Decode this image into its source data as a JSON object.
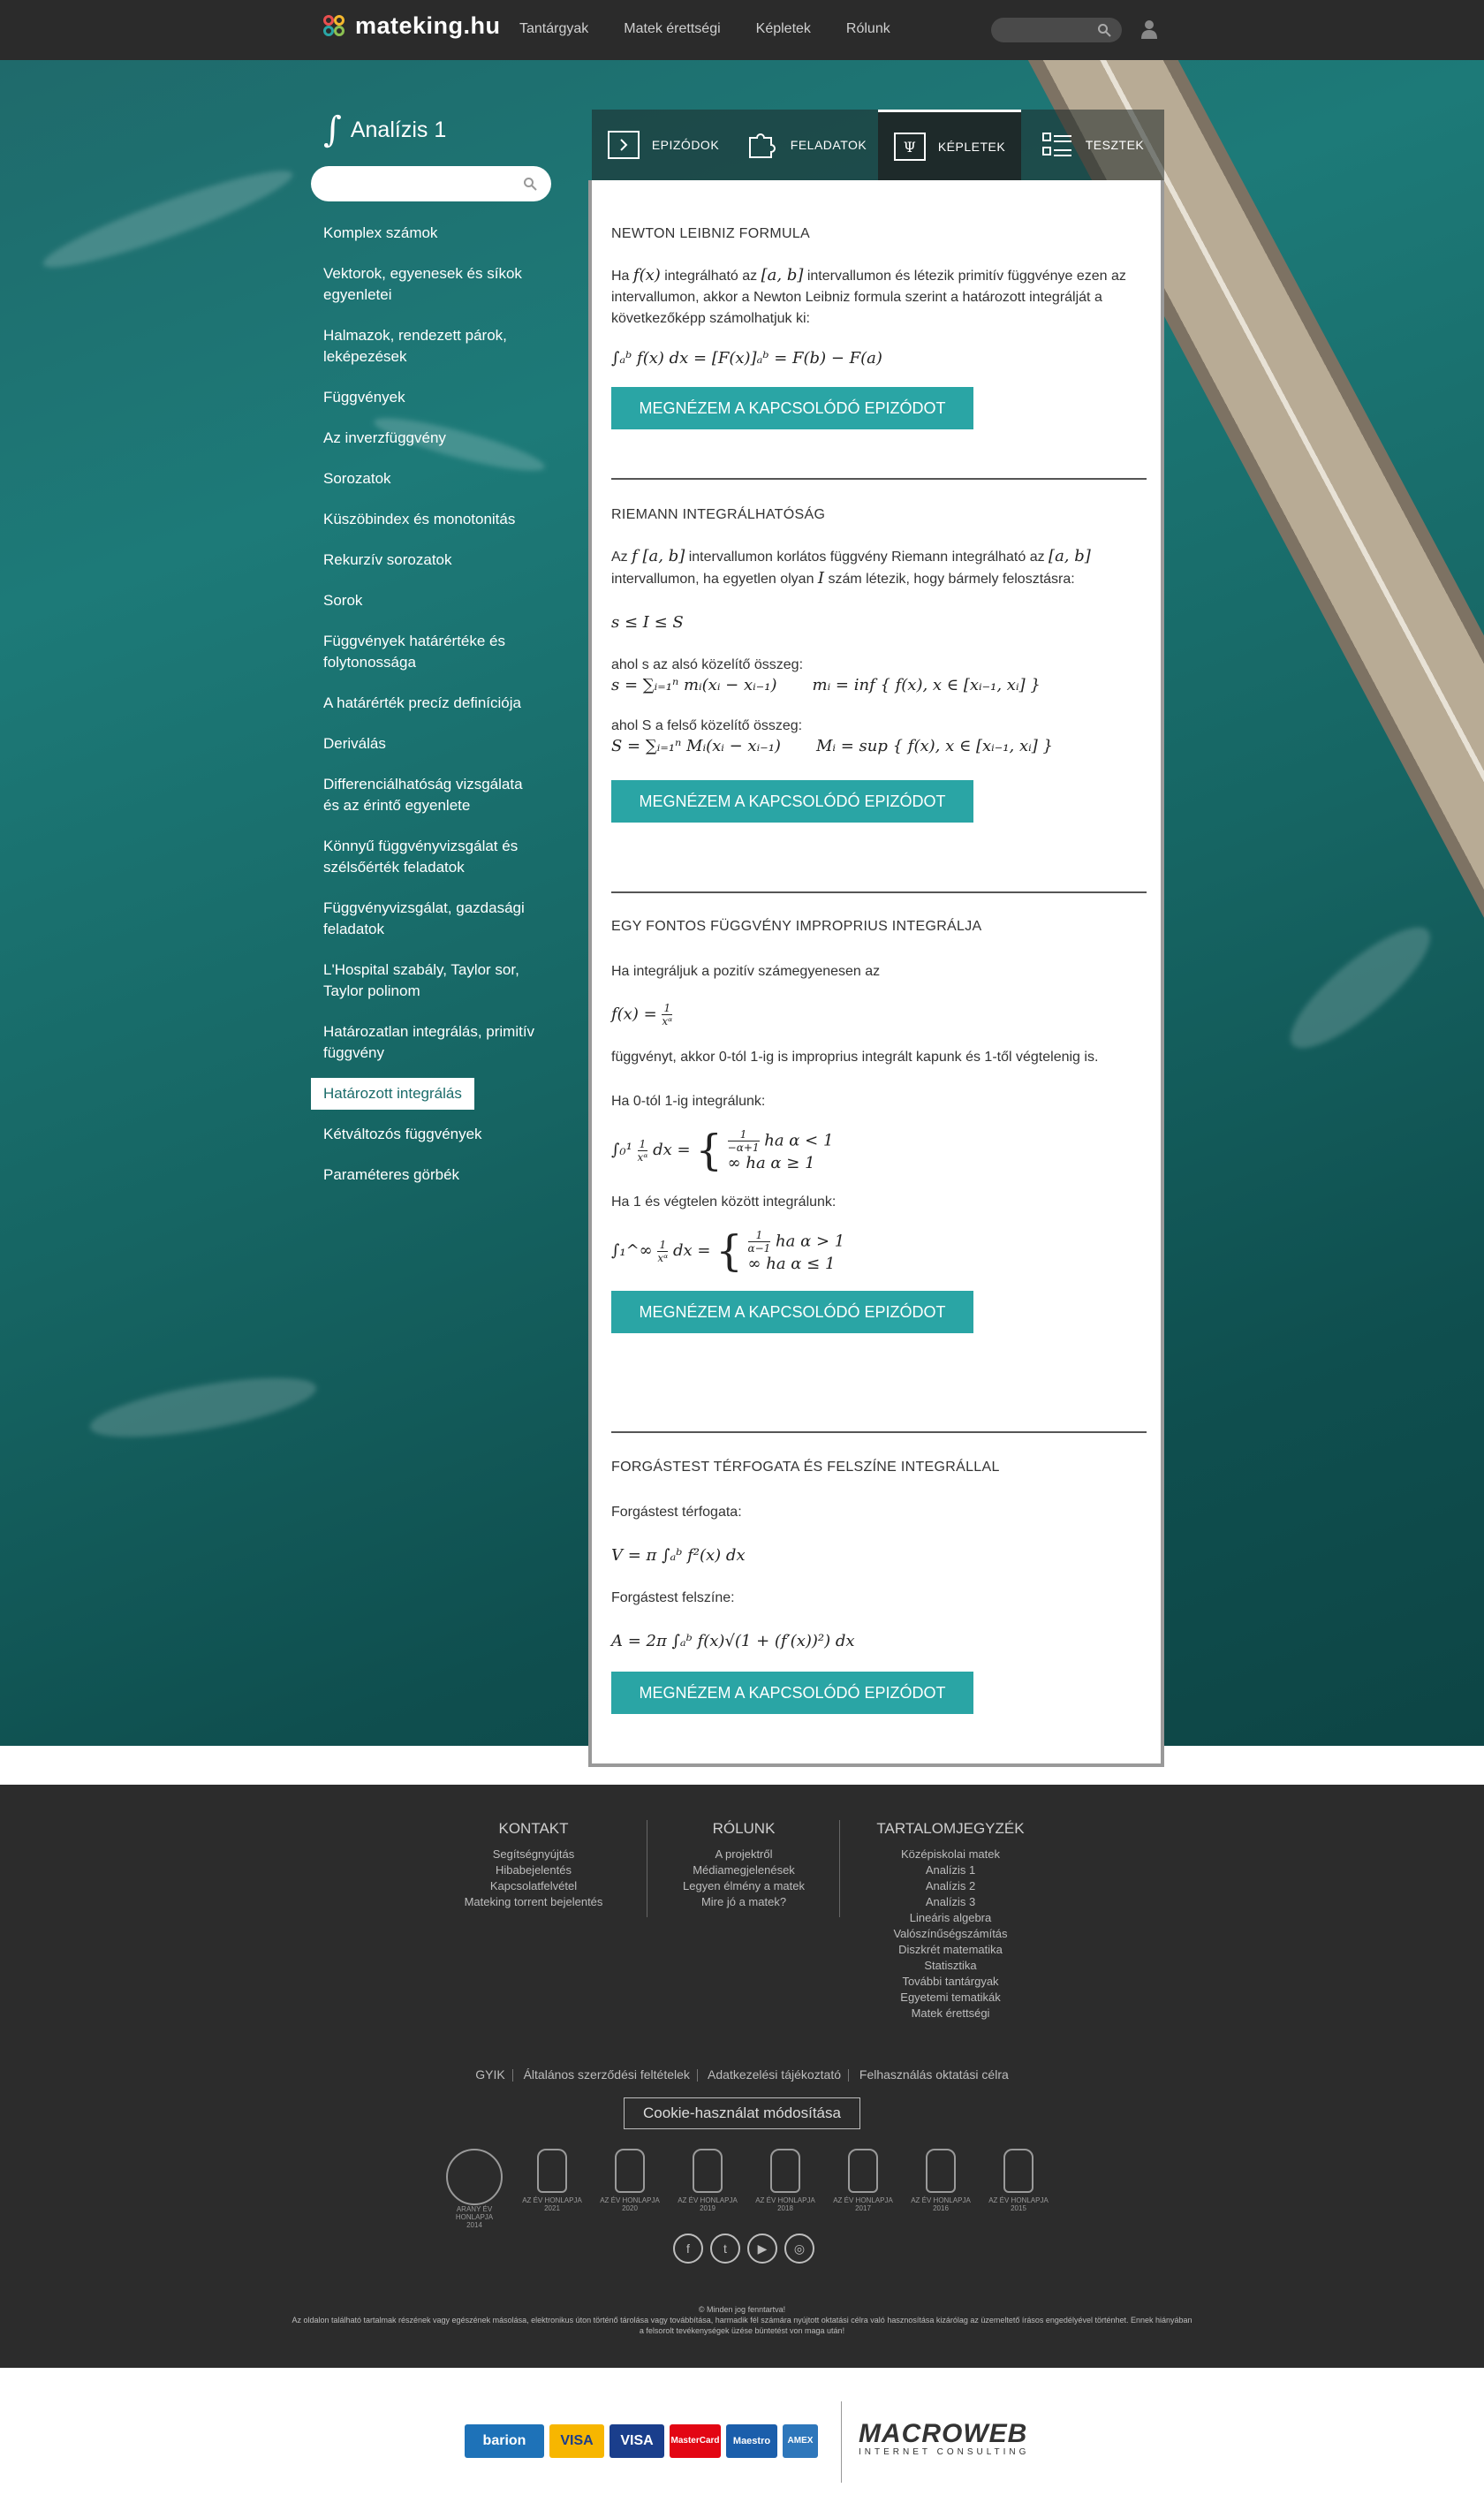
{
  "header": {
    "brand": "mateking.hu",
    "nav": [
      "Tantárgyak",
      "Matek érettségi",
      "Képletek",
      "Rólunk"
    ],
    "color_stripes": [
      "#3aa55b",
      "#2aa5a5",
      "#2aa5a5",
      "#2aa5a5",
      "#f5b82e",
      "#f5b82e",
      "#e86f5a",
      "#e86f5a"
    ]
  },
  "sidebar": {
    "title": "Analízis 1",
    "items": [
      "Komplex számok",
      "Vektorok, egyenesek és síkok egyenletei",
      "Halmazok, rendezett párok, leképezések",
      "Függvények",
      "Az inverzfüggvény",
      "Sorozatok",
      "Küszöbindex és monotonitás",
      "Rekurzív sorozatok",
      "Sorok",
      "Függvények határértéke és folytonossága",
      "A határérték precíz definíciója",
      "Deriválás",
      "Differenciálhatóság vizsgálata és az érintő egyenlete",
      "Könnyű függvényvizsgálat és szélsőérték feladatok",
      "Függvényvizsgálat, gazdasági feladatok",
      "L'Hospital szabály, Taylor sor, Taylor polinom",
      "Határozatlan integrálás, primitív függvény",
      "Határozott integrálás",
      "Kétváltozós függvények",
      "Paraméteres görbék"
    ],
    "active_index": 17
  },
  "tabs": [
    "EPIZÓDOK",
    "FELADATOK",
    "KÉPLETEK",
    "TESZTEK"
  ],
  "active_tab": "KÉPLETEK",
  "button_label": "MEGNÉZEM A KAPCSOLÓDÓ EPIZÓDOT",
  "sections": {
    "s1": {
      "title": "NEWTON LEIBNIZ FORMULA",
      "p1a": "Ha ",
      "p1b": "f(x)",
      "p1c": " integrálható az ",
      "p1d": "[a, b]",
      "p1e": " intervallumon és létezik primitív függvénye ezen az intervallumon, akkor a Newton Leibniz formula szerint a határozott integrálját a következőképp számolhatjuk ki:",
      "formula": "∫ₐᵇ f(x) dx = [F(x)]ₐᵇ = F(b) − F(a)"
    },
    "s2": {
      "title": "RIEMANN INTEGRÁLHATÓSÁG",
      "p1a": "Az ",
      "p1b": "f [a, b]",
      "p1c": " intervallumon korlátos függvény Riemann integrálható az ",
      "p1d": "[a, b]",
      "p1e": " intervallumon, ha egyetlen olyan ",
      "p1f": "I",
      "p1g": " szám létezik, hogy bármely felosztásra:",
      "ineq": "s ≤ I ≤ S",
      "lower_label": "ahol s az alsó közelítő összeg:",
      "lower_formula": "s = ∑ᵢ₌₁ⁿ mᵢ(xᵢ − xᵢ₋₁)",
      "lower_inf": "mᵢ = inf { f(x),  x ∈ [xᵢ₋₁, xᵢ] }",
      "upper_label": "ahol S a felső közelítő összeg:",
      "upper_formula": "S = ∑ᵢ₌₁ⁿ Mᵢ(xᵢ − xᵢ₋₁)",
      "upper_sup": "Mᵢ = sup { f(x),  x ∈ [xᵢ₋₁, xᵢ] }"
    },
    "s3": {
      "title": "EGY FONTOS FÜGGVÉNY IMPROPRIUS INTEGRÁLJA",
      "p1": "Ha integráljuk a pozitív számegyenesen az",
      "fx": "f(x) =",
      "f_num": "1",
      "f_den": "xᵅ",
      "p2": "függvényt, akkor 0-tól 1-ig is improprius integrált kapunk és 1-től végtelenig is.",
      "p3": "Ha 0-tól 1-ig integrálunk:",
      "int1_lhs": "∫₀¹",
      "int1_dx": "dx =",
      "int1_case1_num": "1",
      "int1_case1_den": "−α+1",
      "int1_case1_cond": "ha α < 1",
      "int1_case2": "∞ ha α ≥ 1",
      "p4": "Ha 1 és végtelen között integrálunk:",
      "int2_lhs": "∫₁^∞",
      "int2_dx": "dx =",
      "int2_case1_num": "1",
      "int2_case1_den": "α−1",
      "int2_case1_cond": "ha α > 1",
      "int2_case2": "∞ ha α ≤ 1"
    },
    "s4": {
      "title": "FORGÁSTEST TÉRFOGATA ÉS FELSZÍNE INTEGRÁLLAL",
      "vol_label": "Forgástest térfogata:",
      "vol_formula": "V = π ∫ₐᵇ f²(x) dx",
      "surf_label": "Forgástest felszíne:",
      "surf_formula": "A = 2π ∫ₐᵇ f(x)√(1 + (f′(x))²) dx"
    }
  },
  "footer": {
    "kontakt": {
      "title": "KONTAKT",
      "links": [
        "Segítségnyújtás",
        "Hibabejelentés",
        "Kapcsolatfelvétel",
        "Mateking torrent bejelentés"
      ]
    },
    "rolunk": {
      "title": "RÓLUNK",
      "links": [
        "A projektről",
        "Médiamegjelenések",
        "Legyen élmény a matek",
        "Mire jó a matek?"
      ]
    },
    "toc": {
      "title": "TARTALOMJEGYZÉK",
      "links": [
        "Középiskolai matek",
        "Analízis 1",
        "Analízis 2",
        "Analízis 3",
        "Lineáris algebra",
        "Valószínűségszámítás",
        "Diszkrét matematika",
        "Statisztika",
        "További tantárgyak",
        "Egyetemi tematikák",
        "Matek érettségi"
      ]
    },
    "legal": [
      "GYIK",
      "Általános szerződési feltételek",
      "Adatkezelési tájékoztató",
      "Felhasználás oktatási célra"
    ],
    "cookie": "Cookie-használat módosítása",
    "awards": [
      {
        "label": "ARANY ÉV HONLAPJA",
        "year": "2014"
      },
      {
        "label": "AZ ÉV HONLAPJA",
        "year": "2021"
      },
      {
        "label": "AZ ÉV HONLAPJA",
        "year": "2020"
      },
      {
        "label": "AZ ÉV HONLAPJA",
        "year": "2019"
      },
      {
        "label": "AZ ÉV HONLAPJA",
        "year": "2018"
      },
      {
        "label": "AZ ÉV HONLAPJA",
        "year": "2017"
      },
      {
        "label": "AZ ÉV HONLAPJA",
        "year": "2016"
      },
      {
        "label": "AZ ÉV HONLAPJA",
        "year": "2015"
      }
    ],
    "socials": [
      "f",
      "t",
      "▶",
      "◎"
    ],
    "copyright": "© Minden jog fenntartva!",
    "disclaimer": "Az oldalon található tartalmak részének vagy egészének másolása, elektronikus úton történő tárolása vagy továbbítása, harmadik fél számára nyújtott oktatási célra való hasznosítása kizárólag az üzemeltető írásos engedélyével történhet. Ennek hiányában a felsorolt tevékenységek üzése büntetést von maga után!"
  },
  "payment": {
    "cards": [
      {
        "name": "barion",
        "color": "#1e72b8"
      },
      {
        "name": "VISA",
        "color": "#f7b600"
      },
      {
        "name": "VISA",
        "color": "#1a3e8c"
      },
      {
        "name": "MasterCard",
        "color": "#e30613"
      },
      {
        "name": "Maestro",
        "color": "#1b5eab"
      },
      {
        "name": "AMEX",
        "color": "#2e77bb"
      }
    ],
    "partner": "MACROWEB",
    "partner_sub": "INTERNET CONSULTING"
  }
}
